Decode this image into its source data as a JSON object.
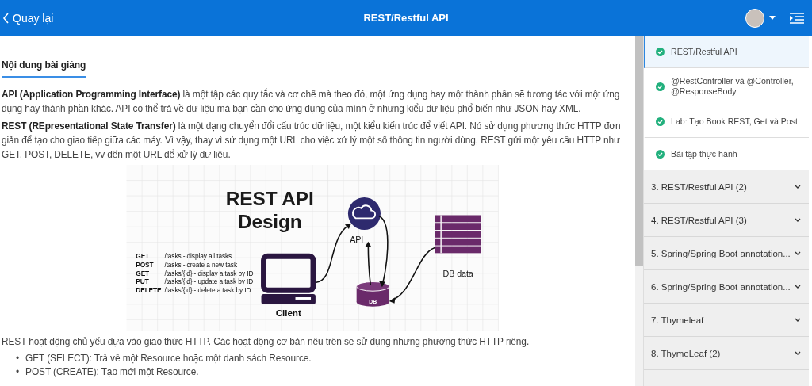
{
  "header": {
    "back": "Quay lại",
    "title": "REST/Restful API"
  },
  "tab": {
    "label": "Nội dung bài giảng",
    "selected": true
  },
  "paragraphs": [
    "**API (Application Programming Interface)** là một tập các quy tắc và cơ chế mà theo đó, một ứng dụng hay một thành phần sẽ tương tác với một ứng dụng hay thành phần khác. API có thể trả về dữ liệu mà bạn cần cho ứng dụng của mình ở những kiểu dữ liệu phổ biến như JSON hay XML.",
    "**REST (REpresentational State Transfer)**  là một dạng chuyển đổi cấu trúc dữ liệu, một kiểu kiến trúc để viết API. Nó sử dụng phương thức HTTP đơn giản để tạo cho giao tiếp giữa các máy. Vì vậy, thay vì sử dụng một URL cho việc xử lý một số thông tin người dùng, REST gửi một yêu cầu HTTP như GET, POST, DELETE, vv đến một URL để xử lý dữ liệu."
  ],
  "diagram": {
    "title_lines": [
      "REST API",
      "Design"
    ],
    "endpoints": [
      {
        "method": "GET",
        "path": "/tasks - display all tasks"
      },
      {
        "method": "POST",
        "path": "/tasks -  create a new task"
      },
      {
        "method": "GET",
        "path": "/tasks/{id} - display a task by ID"
      },
      {
        "method": "PUT",
        "path": "/tasks/{id} - update a task by ID"
      },
      {
        "method": "DELETE",
        "path": "/tasks/{id} - delete a task by ID"
      }
    ],
    "api_label": "API",
    "client_label": "Client",
    "db_label": "DB",
    "db_data_label": "DB data"
  },
  "after_text": "REST hoạt động chủ yếu dựa vào giao thức HTTP. Các hoạt động cơ bản nêu trên sẽ sử dụng những phương thức HTTP riêng.",
  "bullets": [
    {
      "marker": "•",
      "text": "GET (SELECT): Trả về một Resource hoặc một danh sách Resource."
    },
    {
      "marker": "•",
      "text": "POST (CREATE): Tạo mới một Resource."
    }
  ],
  "sidebar": {
    "lessons": [
      {
        "title": "REST/Restful API",
        "done": true,
        "selected": true
      },
      {
        "title": "@RestController và @Controller, @ResponseBody",
        "done": true,
        "selected": false
      },
      {
        "title": "Lab: Tạo Book REST, Get và Post",
        "done": true,
        "selected": false
      },
      {
        "title": "Bài tập thực hành",
        "done": true,
        "selected": false
      }
    ],
    "sections": [
      {
        "title": "3. REST/Restful API (2)",
        "expanded": false
      },
      {
        "title": "4. REST/Restful API (3)",
        "expanded": false
      },
      {
        "title": "5. Spring/Spring Boot annotation...",
        "expanded": false
      },
      {
        "title": "6. Spring/Spring Boot annotation...",
        "expanded": false
      },
      {
        "title": "7. Thymeleaf",
        "expanded": false
      },
      {
        "title": "8. ThymeLeaf (2)",
        "expanded": false
      }
    ]
  }
}
